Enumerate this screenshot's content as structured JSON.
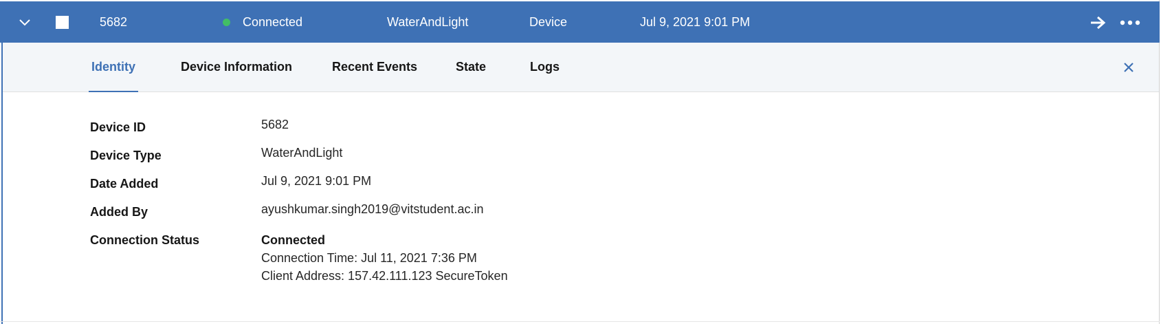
{
  "row": {
    "device_id": "5682",
    "status": "Connected",
    "device_type": "WaterAndLight",
    "class": "Device",
    "date_added": "Jul 9, 2021 9:01 PM",
    "status_color": "#42be65",
    "bar_color": "#3e71b5",
    "icons": [
      "chevron-down-icon",
      "checkbox",
      "arrow-right-icon",
      "overflow-menu-icon"
    ]
  },
  "tabs": [
    {
      "label": "Identity",
      "active": true
    },
    {
      "label": "Device Information"
    },
    {
      "label": "Recent Events"
    },
    {
      "label": "State"
    },
    {
      "label": "Logs"
    }
  ],
  "identity": {
    "fields": [
      {
        "label": "Device ID",
        "value": "5682"
      },
      {
        "label": "Device Type",
        "value": "WaterAndLight"
      },
      {
        "label": "Date Added",
        "value": "Jul 9, 2021 9:01 PM"
      },
      {
        "label": "Added By",
        "value": "ayushkumar.singh2019@vitstudent.ac.in"
      },
      {
        "label": "Connection Status",
        "value": "Connected"
      }
    ],
    "connection_time": "Connection Time: Jul 11, 2021 7:36 PM",
    "client_address": "Client Address: 157.42.111.123 SecureToken"
  }
}
